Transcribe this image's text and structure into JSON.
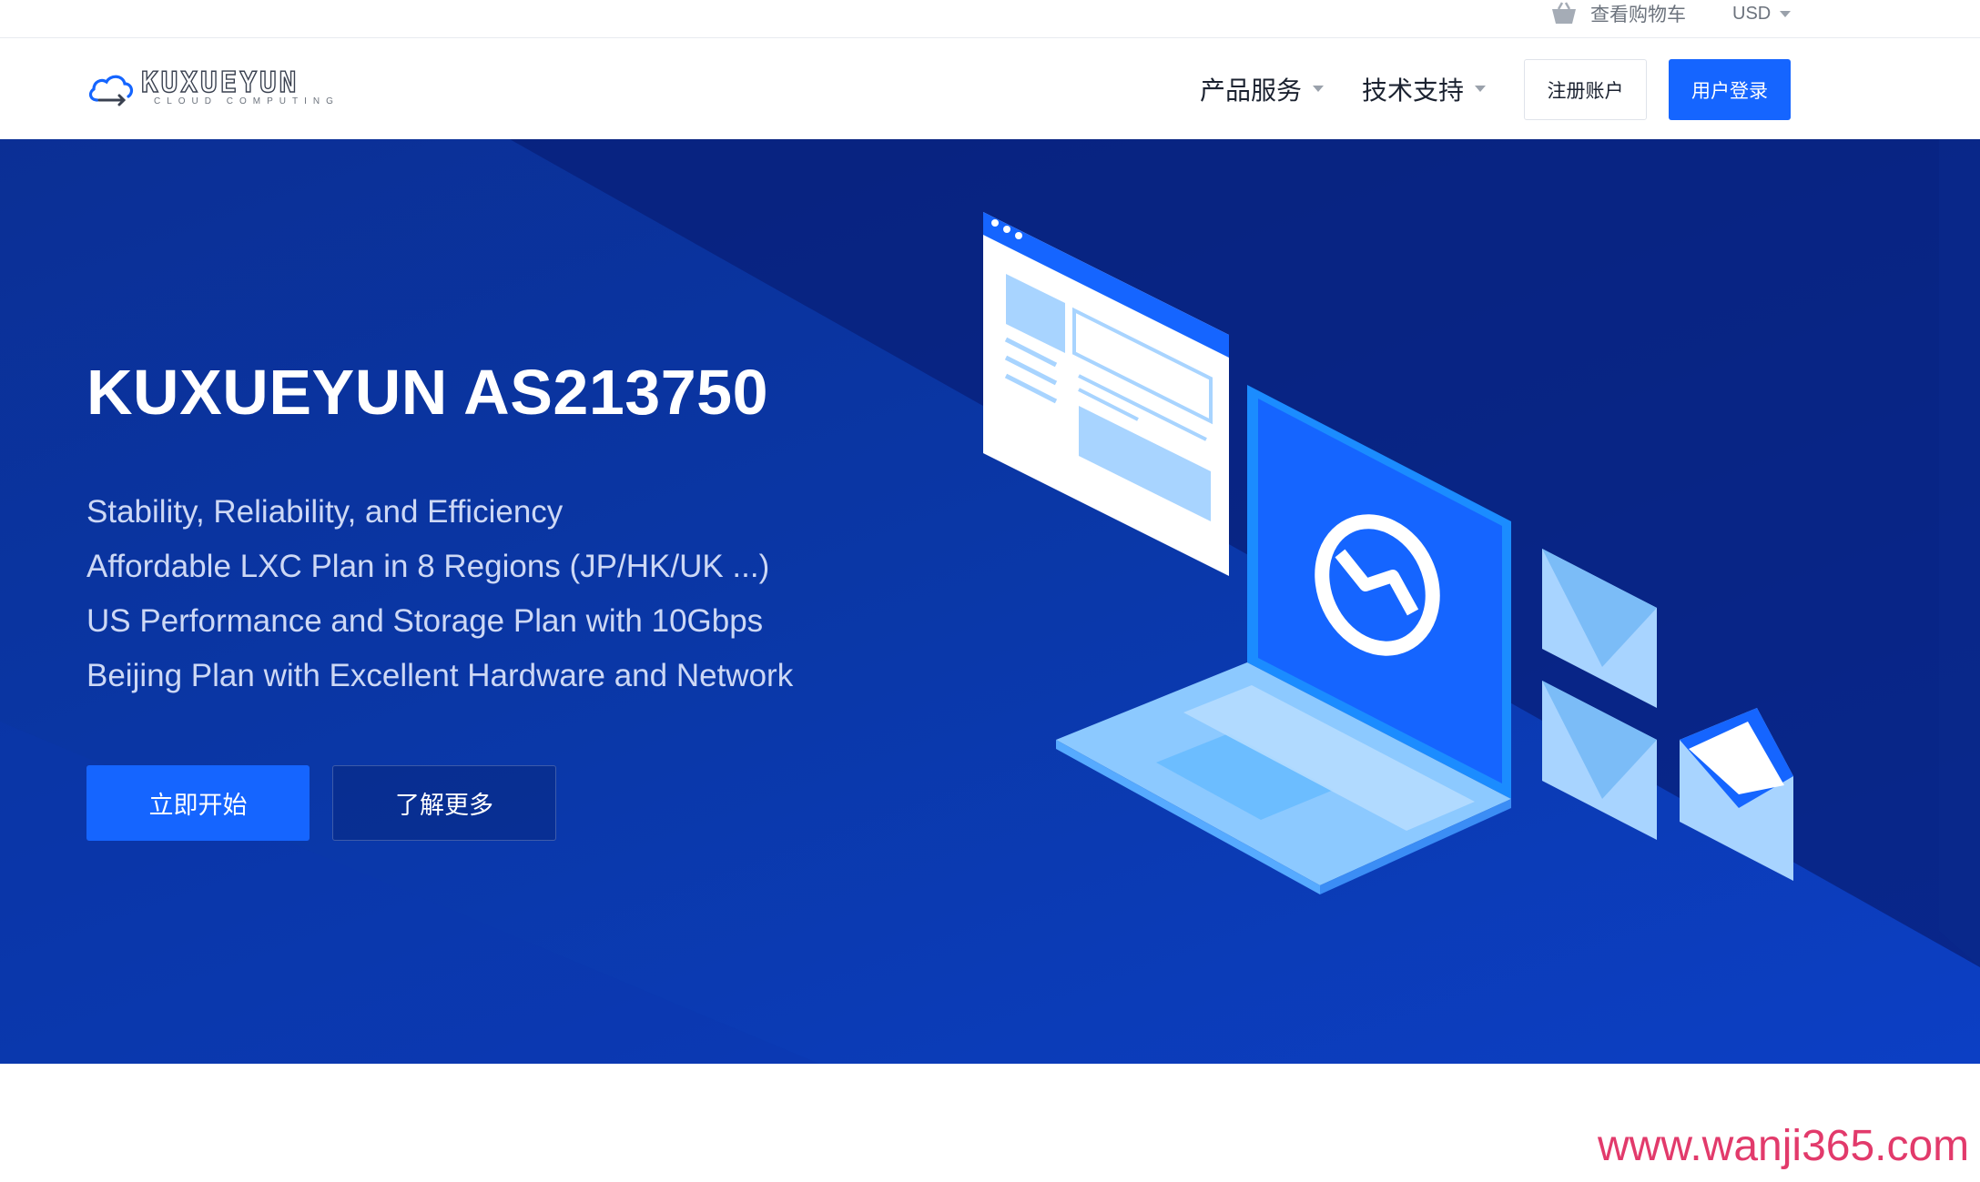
{
  "topbar": {
    "cart_icon": "shopping-basket-icon",
    "cart_label": "查看购物车",
    "currency_label": "USD"
  },
  "nav": {
    "logo_text": "KUXUEYUN",
    "logo_tagline": "CLOUD COMPUTING",
    "products_label": "产品服务",
    "support_label": "技术支持",
    "register_label": "注册账户",
    "login_label": "用户登录"
  },
  "hero": {
    "title": "KUXUEYUN AS213750",
    "lines": [
      "Stability, Reliability, and Efficiency",
      "Affordable LXC Plan in 8 Regions (JP/HK/UK ...)",
      "US Performance and Storage Plan with 10Gbps",
      "Beijing Plan with Excellent Hardware and Network"
    ],
    "start_label": "立即开始",
    "more_label": "了解更多"
  },
  "watermark": "www.wanji365.com",
  "colors": {
    "accent": "#1565ff",
    "hero_bg": "#0a37a6",
    "text_dark": "#1b2230",
    "watermark": "#e23a6b"
  }
}
